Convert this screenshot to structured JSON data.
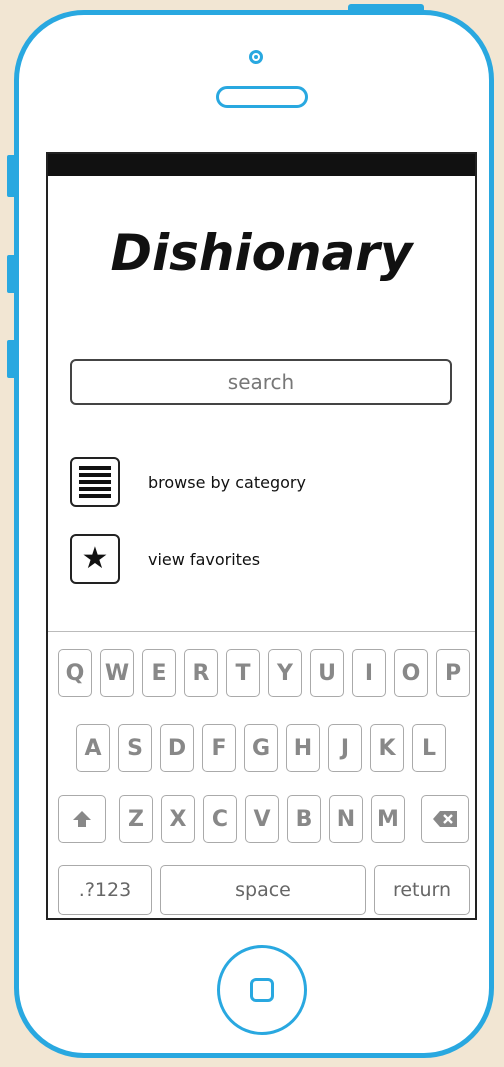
{
  "app": {
    "title": "Dishionary"
  },
  "search": {
    "placeholder": "search"
  },
  "menu": {
    "items": [
      {
        "label": "browse by category",
        "icon": "list-icon"
      },
      {
        "label": "view favorites",
        "icon": "star-icon"
      }
    ]
  },
  "keyboard": {
    "row1": [
      "Q",
      "W",
      "E",
      "R",
      "T",
      "Y",
      "U",
      "I",
      "O",
      "P"
    ],
    "row2": [
      "A",
      "S",
      "D",
      "F",
      "G",
      "H",
      "J",
      "K",
      "L"
    ],
    "row3": [
      "Z",
      "X",
      "C",
      "V",
      "B",
      "N",
      "M"
    ],
    "numbers_label": ".?123",
    "space_label": "space",
    "return_label": "return",
    "shift_icon": "shift-arrow-icon",
    "backspace_icon": "backspace-icon"
  },
  "colors": {
    "device_outline": "#29a8e0",
    "background": "#f2e6d3"
  }
}
